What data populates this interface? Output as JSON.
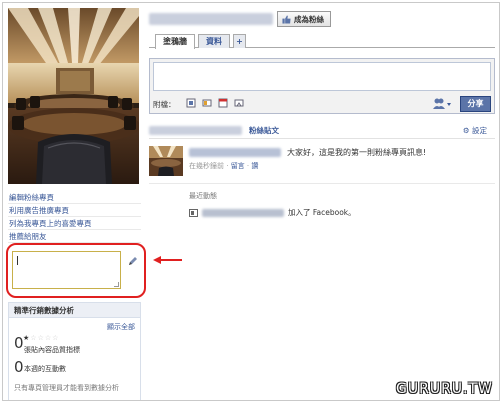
{
  "left": {
    "links": [
      "編輯粉絲專頁",
      "利用廣告推廣專頁",
      "列為我專頁上的喜愛專頁",
      "推薦給朋友"
    ]
  },
  "header": {
    "fan_button": "成為粉絲"
  },
  "tabs": [
    "塗鴉牆",
    "資料",
    "+"
  ],
  "composer": {
    "attach_label": "附檔：",
    "share_label": "分享"
  },
  "posts_bar": {
    "fan_posts": "粉絲貼文",
    "settings": "設定"
  },
  "post": {
    "text": "大家好，這是我的第一則粉絲專頁訊息!",
    "time": "在幾秒鐘前",
    "sep": " · ",
    "comment": "留言",
    "like": "讚"
  },
  "recent": {
    "heading": "最近動態",
    "text": "加入了 Facebook。"
  },
  "insights": {
    "title": "精準行銷數據分析",
    "show_all": "顯示全部",
    "quality_value": "0",
    "quality_label": "張貼內容品質指標",
    "quality_stars": 1,
    "interactions_value": "0",
    "interactions_label": "本週的互動數",
    "note": "只有專頁管理員才能看到數據分析"
  },
  "watermark": "GURURU.TW"
}
